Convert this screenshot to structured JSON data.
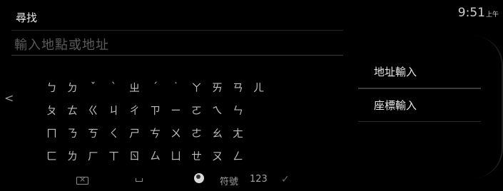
{
  "header": {
    "title": "尋找",
    "time": "9:51",
    "ampm": "上午"
  },
  "search": {
    "placeholder": "輸入地點或地址"
  },
  "nav": {
    "left_arrow": "<"
  },
  "keyboard": {
    "rows": [
      [
        "ㄅ",
        "ㄉ",
        "ˇ",
        "ˋ",
        "ㄓ",
        "ˊ",
        "˙",
        "ㄚ",
        "ㄞ",
        "ㄢ",
        "ㄦ"
      ],
      [
        "ㄆ",
        "ㄊ",
        "ㄍ",
        "ㄐ",
        "ㄔ",
        "ㄗ",
        "ㄧ",
        "ㄛ",
        "ㄟ",
        "ㄣ"
      ],
      [
        "ㄇ",
        "ㄋ",
        "ㄎ",
        "ㄑ",
        "ㄕ",
        "ㄘ",
        "ㄨ",
        "ㄜ",
        "ㄠ",
        "ㄤ"
      ],
      [
        "ㄈ",
        "ㄌ",
        "ㄏ",
        "ㄒ",
        "ㄖ",
        "ㄙ",
        "ㄩ",
        "ㄝ",
        "ㄡ",
        "ㄥ"
      ]
    ],
    "bottom": {
      "symbols": "符號",
      "numbers": "123",
      "confirm": "✓"
    }
  },
  "menu": [
    {
      "label": "地址輸入"
    },
    {
      "label": "座標輸入"
    }
  ]
}
